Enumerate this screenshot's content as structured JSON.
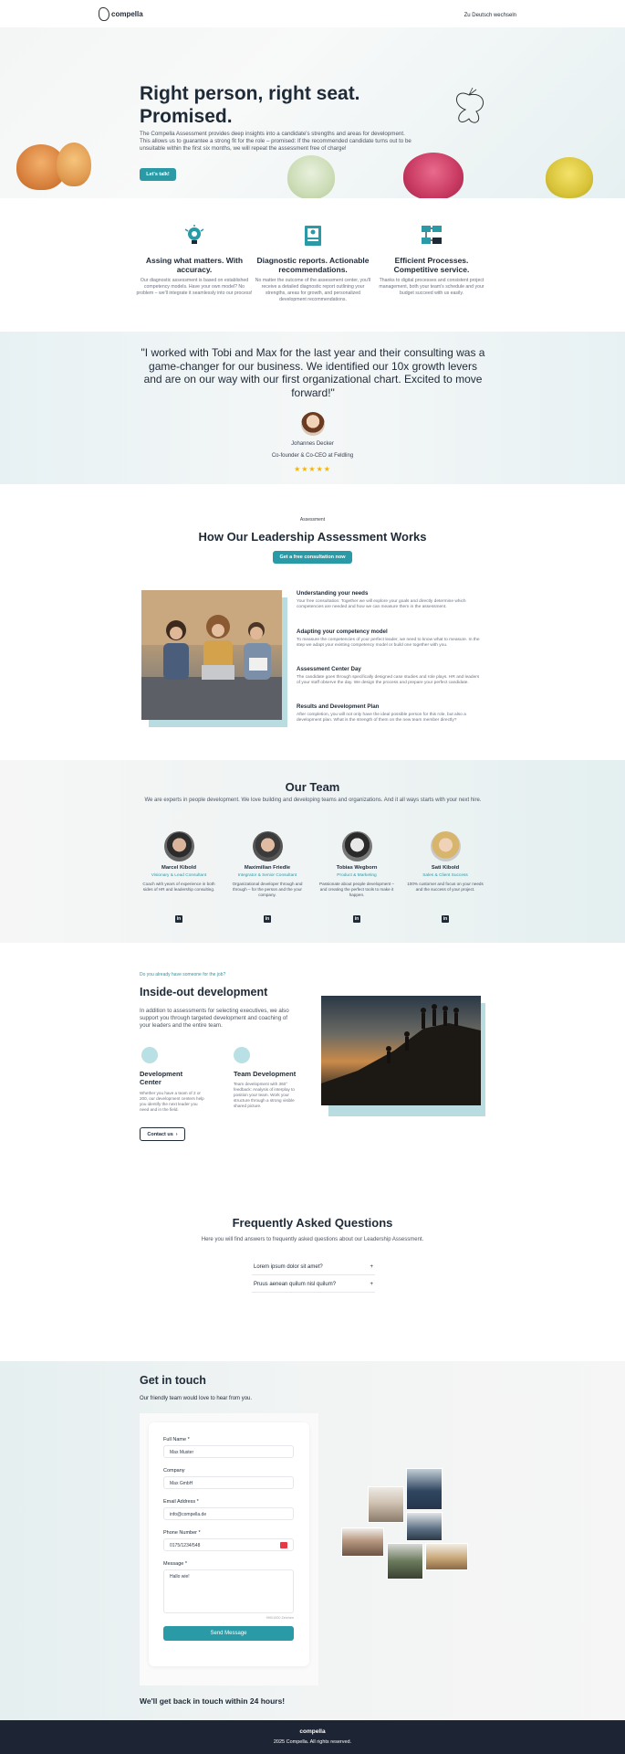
{
  "header": {
    "logo_text": "compella",
    "lang_link": "Zu Deutsch wechseln"
  },
  "hero": {
    "title": "Right person, right seat. Promised.",
    "description": "The Compella Assessment provides deep insights into a candidate's strengths and areas for development. This allows us to guarantee a strong fit for the role – promised: If the recommended candidate turns out to be unsuitable within the first six months, we will repeat the assessment free of charge!",
    "cta_label": "Let's talk!"
  },
  "features": [
    {
      "icon": "target-idea-icon",
      "title": "Assing what matters. With accuracy.",
      "text": "Our diagnostic assessment is based on established competency models. Have your own model? No problem – we'll integrate it seamlessly into our process!"
    },
    {
      "icon": "report-icon",
      "title": "Diagnostic reports. Actionable recommendations.",
      "text": "No matter the outcome of the assessment center, you'll receive a detailed diagnostic report outlining your strengths, areas for growth, and personalized development recommendations."
    },
    {
      "icon": "process-icon",
      "title": "Efficient Processes. Competitive service.",
      "text": "Thanks to digital processes and consistent project management, both your team's schedule and your budget succeed with us easily."
    }
  ],
  "testimonial": {
    "quote": "\"I worked with Tobi and Max for the last year and their consulting was a game-changer for our business. We identified our 10x growth levers and are on our way with our first organizational chart. Excited to move forward!\"",
    "author": "Johannes Decker",
    "role": "Co-founder & Co-CEO at Feldling",
    "stars": "★★★★★"
  },
  "how": {
    "kicker": "Assessment",
    "title": "How Our Leadership Assessment Works",
    "cta_label": "Get a free consultation now",
    "steps": [
      {
        "title": "Understanding your needs",
        "text": "Your free consultation: Together we will explore your goals and directly determine which competencies are needed and how we can measure them in the assessment."
      },
      {
        "title": "Adapting your competency model",
        "text": "To measure the competencies of your perfect leader, we need to know what to measure. In the step we adapt your existing competency model or build one together with you."
      },
      {
        "title": "Assessment Center Day",
        "text": "The candidate goes through specifically designed case studies and role plays. HR and leaders of your staff observe the day. We design the process and prepare your perfect candidate."
      },
      {
        "title": "Results and Development Plan",
        "text": "After completion, you will not only have the ideal possible person for this role, but also a development plan. What is the strength of them on the new team member directly?"
      }
    ]
  },
  "team": {
    "title": "Our Team",
    "subtitle": "We are experts in people development. We love building and developing teams and organizations. And it all ways starts with your next hire.",
    "members": [
      {
        "name": "Marcel Kibold",
        "role": "Visionary & Lead Consultant",
        "bio": "Coach with years of experience in both sides of HR and leadership consulting.",
        "linkedin": "in"
      },
      {
        "name": "Maximilian Friedle",
        "role": "Integrator & Senior Consultant",
        "bio": "Organizational developer through and through – for the person and the your company.",
        "linkedin": "in"
      },
      {
        "name": "Tobias Wegborn",
        "role": "Product & Marketing",
        "bio": "Passionate about people development – and creating the perfect tools to make it happen.",
        "linkedin": "in"
      },
      {
        "name": "Sati Kibold",
        "role": "Sales & Client Success",
        "bio": "100% customer and focus on your needs and the success of your project.",
        "linkedin": "in"
      }
    ]
  },
  "inside_out": {
    "kicker": "Do you already have someone for the job?",
    "title": "Inside-out development",
    "text": "In addition to assessments for selecting executives, we also support you through targeted development and coaching of your leaders and the entire team.",
    "items": [
      {
        "title": "Development Center",
        "text": "Whether you have a team of 2 or 200, our development centers help you identify the next leader you need and in the field."
      },
      {
        "title": "Team Development",
        "text": "Team development with 360° feedback: Analysis of interplay to position your team. Work your structure through a strong visible shared picture."
      }
    ],
    "cta_label": "Contact us"
  },
  "faq": {
    "title": "Frequently Asked Questions",
    "subtitle": "Here you will find answers to frequently asked questions about our Leadership Assessment.",
    "items": [
      {
        "question": "Lorem ipsum dolor sit amet?",
        "toggle": "+"
      },
      {
        "question": "Pruus aenean quilum nisl quilum?",
        "toggle": "+"
      }
    ]
  },
  "contact": {
    "title": "Get in touch",
    "subtitle": "Our friendly team would love to hear from you.",
    "fields": {
      "name_label": "Full Name *",
      "name_value": "Max Muster",
      "company_label": "Company",
      "company_value": "Max GmbH",
      "email_label": "Email Address *",
      "email_value": "info@compella.de",
      "phone_label": "Phone Number *",
      "phone_value": "0175/1234/548",
      "message_label": "Message *",
      "message_value": "Hallo wie!",
      "char_count": "990/1000 Zeichen"
    },
    "send_label": "Send Message",
    "note": "We'll get back in touch within 24 hours!"
  },
  "footer": {
    "logo_text": "compella",
    "copyright": "2025 Compella. All rights reserved."
  },
  "colors": {
    "accent": "#2a9aa6",
    "dark": "#1d2433",
    "star": "#f5b400"
  }
}
